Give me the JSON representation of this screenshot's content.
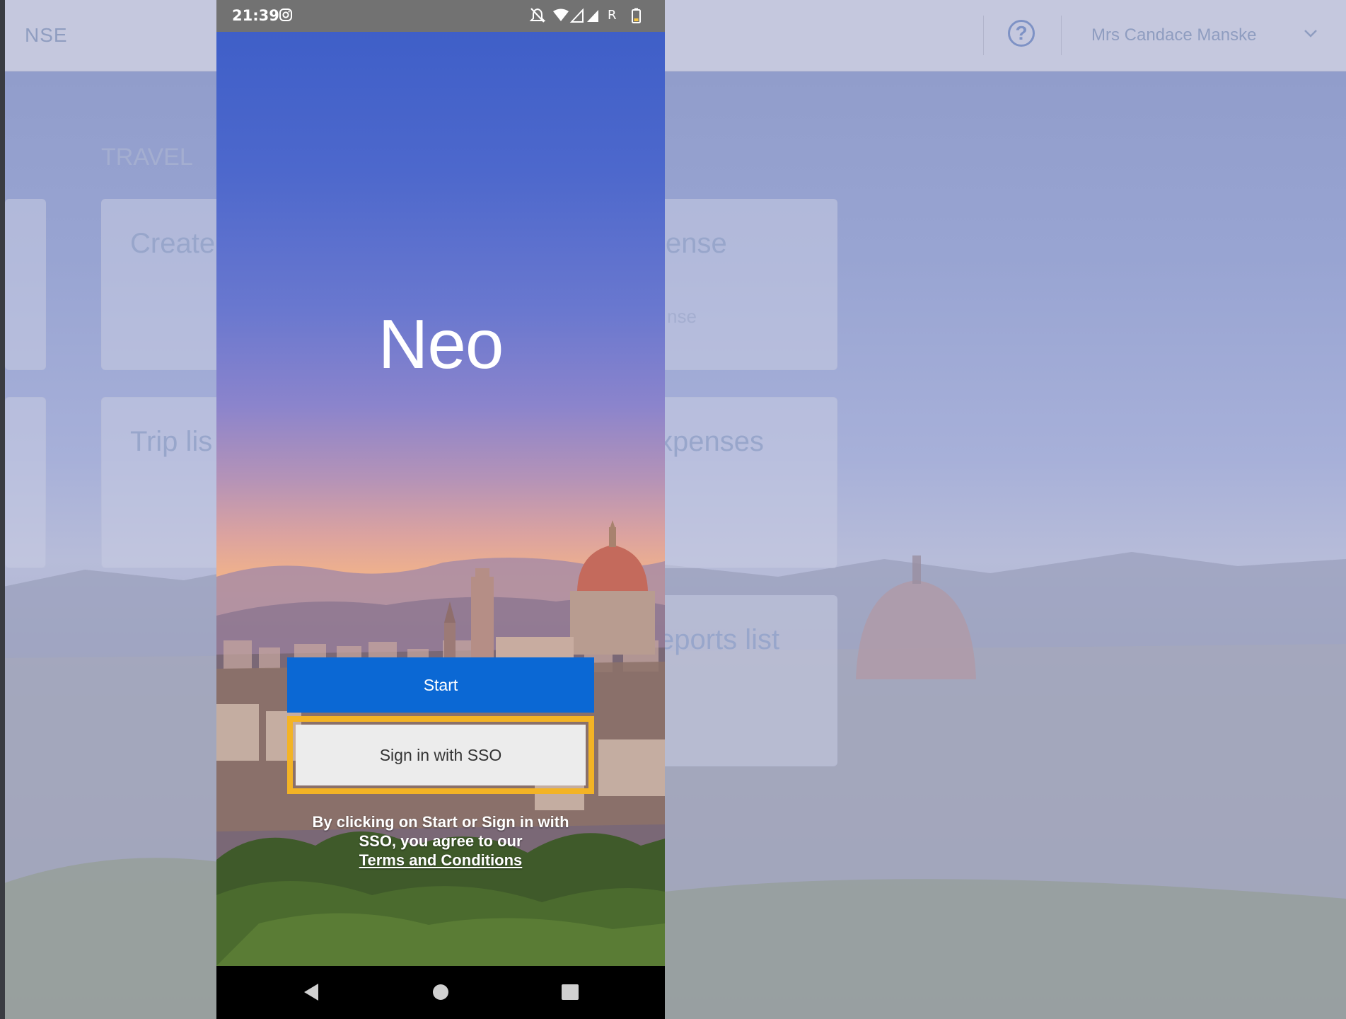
{
  "background": {
    "brand_fragment": "NSE",
    "help_icon_glyph": "?",
    "user_name": "Mrs Candace Manske",
    "section_title": "TRAVEL",
    "cards": [
      {
        "title": "Create",
        "subtitle": ""
      },
      {
        "title": "ense",
        "subtitle": "nse"
      },
      {
        "title": "Trip lis",
        "subtitle": ""
      },
      {
        "title": "xpenses",
        "subtitle": ""
      },
      {
        "title": "eports list",
        "subtitle": ""
      }
    ]
  },
  "status_bar": {
    "time": "21:39",
    "roaming": "R"
  },
  "app": {
    "title": "Neo",
    "start_label": "Start",
    "sso_label": "Sign in with SSO",
    "terms_text": "By clicking on Start or Sign in with SSO, you agree to our",
    "terms_link": "Terms and Conditions"
  },
  "colors": {
    "start_button": "#0b68d4",
    "highlight": "#f3b325",
    "sso_button": "#ececec"
  },
  "icons": {
    "status": [
      "instagram-icon",
      "mute-icon",
      "wifi-icon",
      "signal-icon",
      "battery-icon"
    ],
    "navigation": [
      "back-icon",
      "home-icon",
      "recents-icon"
    ]
  }
}
